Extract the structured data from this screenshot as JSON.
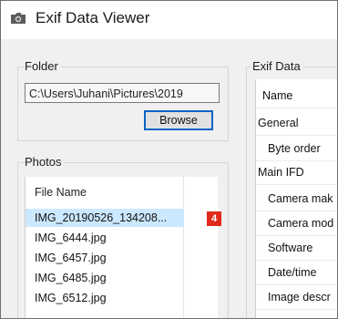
{
  "window": {
    "title": "Exif Data Viewer",
    "icon": "folder-icon"
  },
  "folder": {
    "group_label": "Folder",
    "path_value": "C:\\Users\\Juhani\\Pictures\\2019",
    "browse_label": "Browse"
  },
  "photos": {
    "group_label": "Photos",
    "column_header": "File Name",
    "items": [
      {
        "name": "IMG_20190526_134208..."
      },
      {
        "name": "IMG_6444.jpg"
      },
      {
        "name": "IMG_6457.jpg"
      },
      {
        "name": "IMG_6485.jpg"
      },
      {
        "name": "IMG_6512.jpg"
      }
    ],
    "selected_badge": "4"
  },
  "exif": {
    "group_label": "Exif Data",
    "column_header": "Name",
    "rows": [
      {
        "label": "General",
        "kind": "category"
      },
      {
        "label": "Byte order",
        "kind": "field"
      },
      {
        "label": "Main IFD",
        "kind": "category"
      },
      {
        "label": "Camera mak",
        "kind": "field"
      },
      {
        "label": "Camera mod",
        "kind": "field"
      },
      {
        "label": "Software",
        "kind": "field"
      },
      {
        "label": "Date/time",
        "kind": "field"
      },
      {
        "label": "Image descr",
        "kind": "field"
      }
    ]
  },
  "colors": {
    "selection": "#cce8ff",
    "badge": "#e0291b",
    "button_border": "#0a64c8"
  }
}
